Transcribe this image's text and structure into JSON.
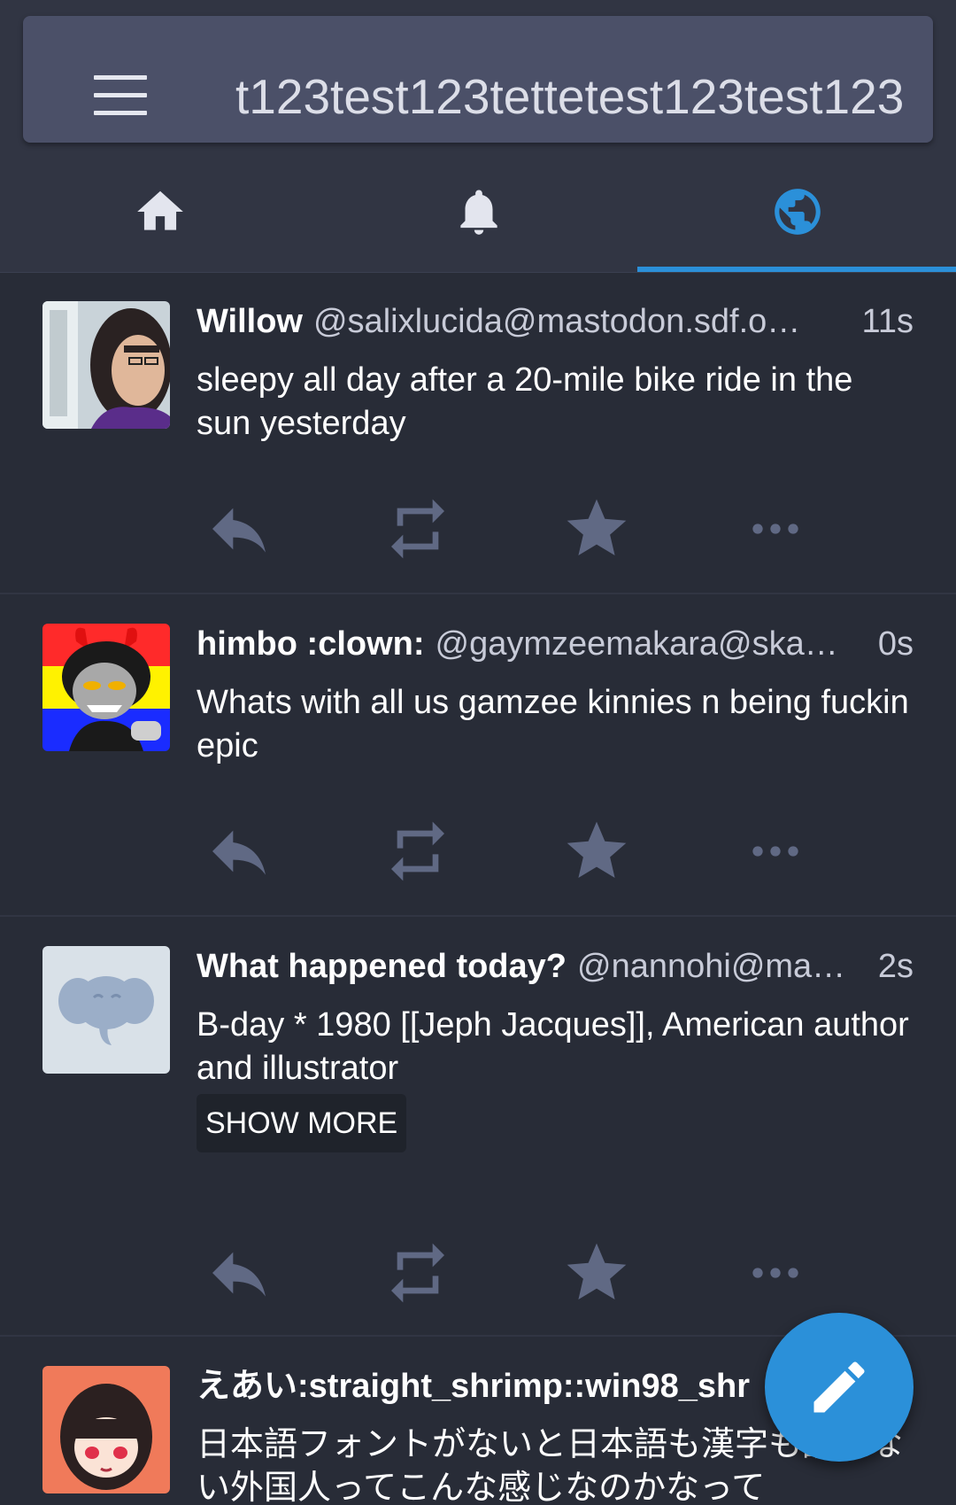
{
  "search": {
    "text": "t123test123tettetest123test123"
  },
  "tabs": [
    {
      "name": "home",
      "icon": "home-icon"
    },
    {
      "name": "notifications",
      "icon": "bell-icon"
    },
    {
      "name": "federated",
      "icon": "globe-icon",
      "active": true
    }
  ],
  "colors": {
    "accent": "#2b90d9",
    "background": "#282c37",
    "icon_muted": "#606984"
  },
  "statuses": [
    {
      "name": "Willow",
      "acct": "@salixlucida@mastodon.sdf.o…",
      "time": "11s",
      "content": "sleepy all day after a 20-mile bike ride in the sun yesterday"
    },
    {
      "name": "himbo :clown:",
      "acct": "@gaymzeemakara@ska…",
      "time": "0s",
      "content": "Whats with all us gamzee kinnies n being fuckin epic"
    },
    {
      "name": "What happened today?",
      "acct": "@nannohi@ma…",
      "time": "2s",
      "content": "B-day *  1980   [[Jeph Jacques]], American author and illustrator",
      "show_more": "SHOW MORE"
    },
    {
      "name": "えあい:straight_shrimp::win98_shr",
      "acct": "",
      "time": "",
      "content": "日本語フォントがないと日本語も漢字も読めない外国人ってこんな感じなのかなって"
    }
  ],
  "action_icons": [
    "reply-icon",
    "boost-icon",
    "favourite-icon",
    "more-icon"
  ],
  "fab": {
    "icon": "compose-pencil-icon"
  }
}
